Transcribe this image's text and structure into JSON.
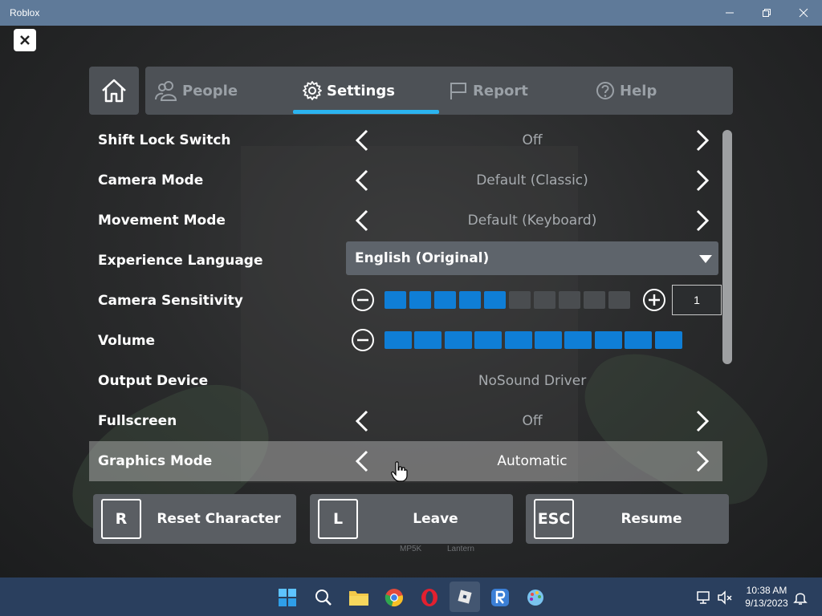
{
  "window": {
    "title": "Roblox"
  },
  "colors": {
    "accent": "#2bb4f0",
    "bar_on": "#0f7ed6",
    "bar_off": "#4a4d50",
    "taskbar": "#2a3f5e"
  },
  "tabs": [
    {
      "label": "People",
      "icon": "people-icon"
    },
    {
      "label": "Settings",
      "icon": "gear-icon",
      "active": true
    },
    {
      "label": "Report",
      "icon": "flag-icon"
    },
    {
      "label": "Help",
      "icon": "help-icon"
    }
  ],
  "settings": {
    "shift_lock": {
      "label": "Shift Lock Switch",
      "value": "Off"
    },
    "camera_mode": {
      "label": "Camera Mode",
      "value": "Default (Classic)"
    },
    "movement_mode": {
      "label": "Movement Mode",
      "value": "Default (Keyboard)"
    },
    "language": {
      "label": "Experience Language",
      "value": "English (Original)"
    },
    "camera_sensitivity": {
      "label": "Camera Sensitivity",
      "level": 5,
      "steps": 10,
      "value": "1"
    },
    "volume": {
      "label": "Volume",
      "level": 10,
      "steps": 10
    },
    "output_device": {
      "label": "Output Device",
      "value": "NoSound Driver"
    },
    "fullscreen": {
      "label": "Fullscreen",
      "value": "Off"
    },
    "graphics_mode": {
      "label": "Graphics Mode",
      "value": "Automatic"
    }
  },
  "actions": {
    "reset": {
      "key": "R",
      "label": "Reset Character"
    },
    "leave": {
      "key": "L",
      "label": "Leave"
    },
    "resume": {
      "key": "ESC",
      "label": "Resume"
    }
  },
  "background": {
    "nametag_1": "MP5K",
    "nametag_2": "Lantern"
  },
  "taskbar": {
    "time": "10:38 AM",
    "date": "9/13/2023"
  }
}
